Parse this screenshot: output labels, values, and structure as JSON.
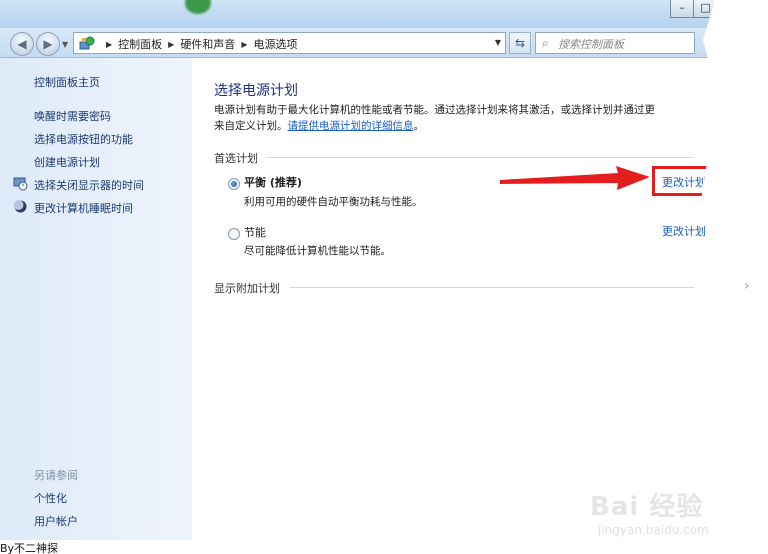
{
  "titlebar": {
    "blurred_title": "…",
    "buttons": [
      "–",
      "□"
    ]
  },
  "addressbar": {
    "crumbs": [
      "控制面板",
      "硬件和声音",
      "电源选项"
    ],
    "search_placeholder": "搜索控制面板"
  },
  "sidebar": {
    "links": [
      {
        "label": "控制面板主页",
        "icon": null
      },
      {
        "label": "唤醒时需要密码",
        "icon": null
      },
      {
        "label": "选择电源按钮的功能",
        "icon": null
      },
      {
        "label": "创建电源计划",
        "icon": null
      },
      {
        "label": "选择关闭显示器的时间",
        "icon": "monitor-clock-icon"
      },
      {
        "label": "更改计算机睡眠时间",
        "icon": "moon-icon"
      }
    ],
    "see_also_heading": "另请参阅",
    "see_also": [
      "个性化",
      "用户帐户"
    ]
  },
  "main": {
    "title": "选择电源计划",
    "description_line1": "电源计划有助于最大化计算机的性能或者节能。通过选择计划来将其激活，或选择计划并通过更",
    "description_prefix": "来自定义计划。",
    "description_link": "请提供电源计划的详细信息",
    "description_suffix": "。",
    "preferred_heading": "首选计划",
    "plans": [
      {
        "name": "平衡 (推荐)",
        "desc": "利用可用的硬件自动平衡功耗与性能。",
        "selected": true,
        "change_label": "更改计划"
      },
      {
        "name": "节能",
        "desc": "尽可能降低计算机性能以节能。",
        "selected": false,
        "change_label": "更改计划"
      }
    ],
    "additional_heading": "显示附加计划"
  },
  "footer": {
    "by_text": "By不二神探"
  },
  "watermark": {
    "main": "Bai 经验",
    "sub": "jingyan.baidu.com"
  },
  "colors": {
    "accent_red": "#e41e1e",
    "link_blue": "#1c5fc4",
    "title_blue": "#1e3287"
  }
}
